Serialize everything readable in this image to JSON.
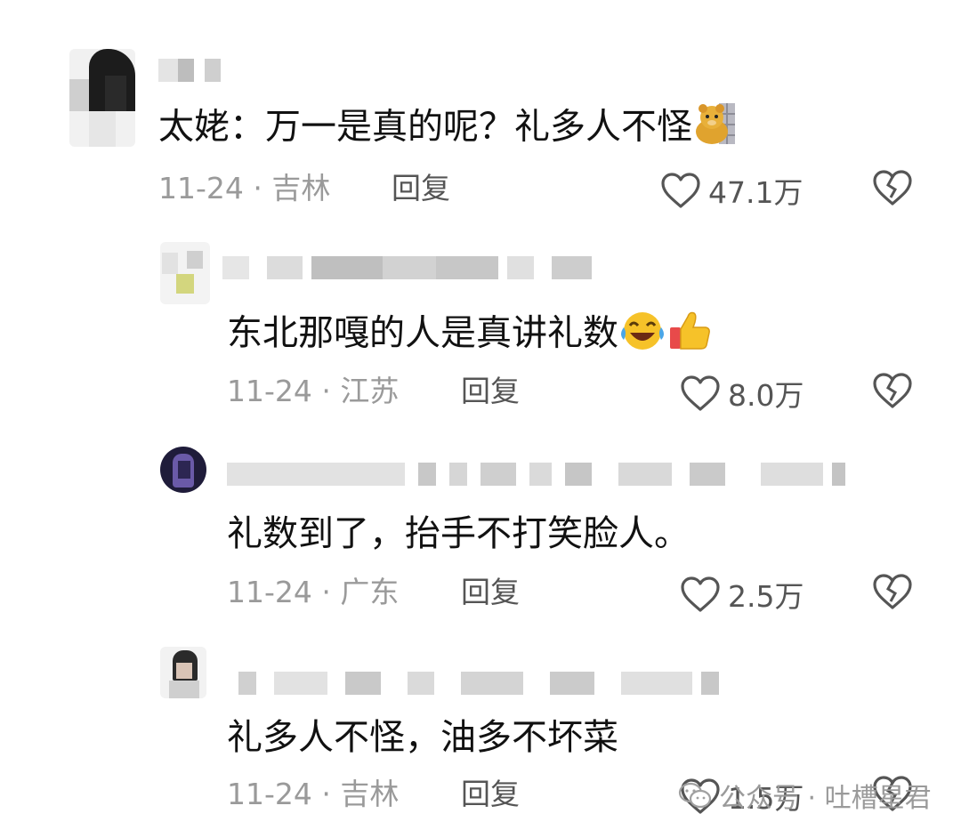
{
  "comments": [
    {
      "text": "太姥：万一是真的呢？礼多人不怪",
      "date_location": "11-24 · 吉林",
      "reply_label": "回复",
      "likes": "47.1万",
      "emoji": "bear-emoji"
    },
    {
      "text": "东北那嘎的人是真讲礼数",
      "date_location": "11-24 · 江苏",
      "reply_label": "回复",
      "likes": "8.0万",
      "emoji": "laughing-crying-and-thumbs-up-emoji"
    },
    {
      "text": "礼数到了，抬手不打笑脸人。",
      "date_location": "11-24 · 广东",
      "reply_label": "回复",
      "likes": "2.5万"
    },
    {
      "text": "礼多人不怪，油多不坏菜",
      "date_location": "11-24 · 吉林",
      "reply_label": "回复",
      "likes": "1.5万"
    }
  ],
  "watermark": {
    "text": "公众号 · 吐槽星君",
    "icon": "wechat-icon"
  },
  "colors": {
    "text": "#111111",
    "meta": "#9a9a9a",
    "icon": "#555555"
  }
}
